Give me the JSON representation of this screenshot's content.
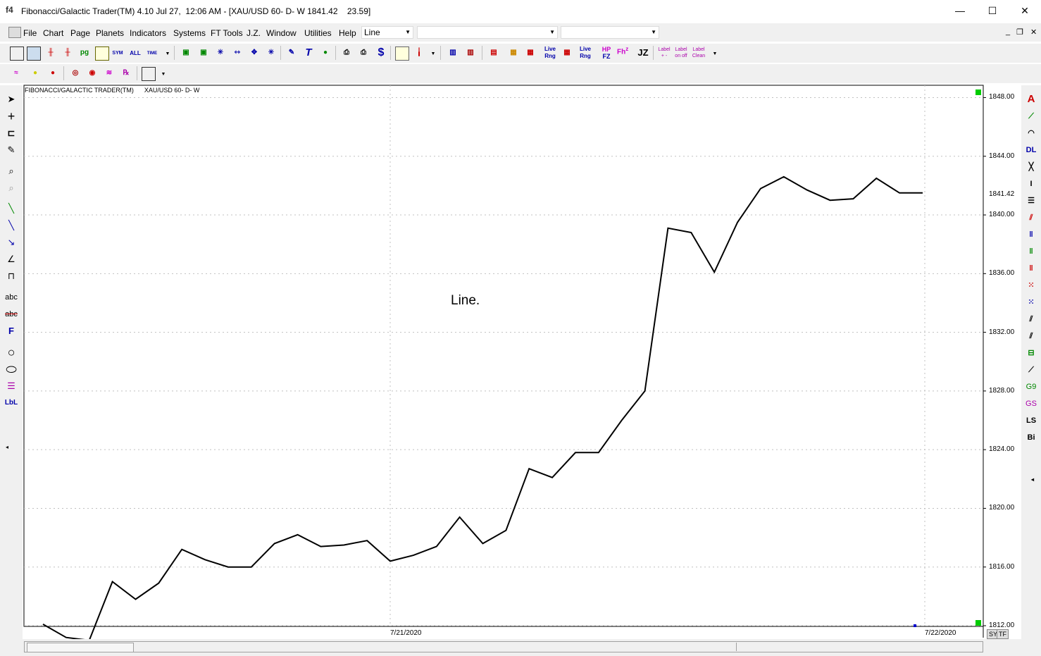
{
  "window": {
    "title": "Fibonacci/Galactic Trader(TM) 4.10 Jul 27,  12:06 AM - [XAU/USD 60- D- W 1841.42    23.59]",
    "app_icon": "f4",
    "minimize": "—",
    "maximize": "☐",
    "close": "✕"
  },
  "menu": {
    "items": [
      "File",
      "Chart",
      "Page",
      "Planets",
      "Indicators",
      "Systems",
      "FT Tools",
      "J.Z.",
      "Window",
      "Utilities",
      "Help"
    ],
    "chart_type_value": "Line",
    "combo2_value": "",
    "combo3_value": "",
    "mdi_minimize": "_",
    "mdi_restore": "❐",
    "mdi_close": "✕"
  },
  "toolbar1": {
    "labels": {
      "sym": "SYM",
      "all": "ALL",
      "time": "TIME",
      "pg": "pg",
      "live_rng_1_top": "Live",
      "live_rng_1_bottom": "Rng",
      "live_rng_2_top": "Live",
      "live_rng_2_bottom": "Rng",
      "hp": "HP",
      "fz": "FZ",
      "fh": "Fh",
      "z": "z",
      "jz": "JZ",
      "label1_top": "Label",
      "label1_bottom": "+ -",
      "label2_top": "Label",
      "label2_bottom": "on off",
      "label3_top": "Label",
      "label3_bottom": "Clean",
      "dollar": "$",
      "tee": "T"
    }
  },
  "left_tools": {
    "abc": "abc",
    "abc_strike": "abc",
    "f": "F",
    "lbl": "LbL"
  },
  "right_tools": {
    "a": "A",
    "dl": "DL",
    "i": "I",
    "g9": "G9",
    "gs": "GS",
    "ls": "LS",
    "bi": "Bi"
  },
  "chart": {
    "header": "FIBONACCI/GALACTIC TRADER(TM)      XAU/USD 60- D- W",
    "annotation": "Line.",
    "current_price_label": "1841.42",
    "sy": "SY",
    "tf": "TF",
    "colors": {
      "line": "#000000",
      "grid": "#c0c0c0",
      "marker": "#00cc00",
      "blue_marker": "#0000cc"
    }
  },
  "chart_data": {
    "type": "line",
    "title": "",
    "xlabel": "",
    "ylabel": "",
    "y_ticks": [
      1848.0,
      1844.0,
      1840.0,
      1836.0,
      1832.0,
      1828.0,
      1824.0,
      1820.0,
      1816.0,
      1812.0
    ],
    "y_tick_labels": [
      "1848.00",
      "1844.00",
      "1840.00",
      "1836.00",
      "1832.00",
      "1828.00",
      "1824.00",
      "1820.00",
      "1816.00",
      "1812.00"
    ],
    "x_tick_labels": [
      "7/21/2020",
      "7/22/2020"
    ],
    "ylim": [
      1812.0,
      1848.4
    ],
    "grid": true,
    "series": [
      {
        "values": [
          1812.1,
          1811.2,
          1811.0,
          1815.0,
          1813.8,
          1814.9,
          1817.2,
          1816.5,
          1816.0,
          1816.0,
          1817.6,
          1818.2,
          1817.4,
          1817.5,
          1817.8,
          1816.4,
          1816.8,
          1817.4,
          1819.4,
          1817.6,
          1818.5,
          1822.7,
          1822.1,
          1823.8,
          1823.8,
          1826.0,
          1828.0,
          1839.1,
          1838.8,
          1836.1,
          1839.5,
          1841.8,
          1842.6,
          1841.7,
          1841.0,
          1841.1,
          1842.5,
          1841.5,
          1841.5
        ]
      }
    ]
  }
}
